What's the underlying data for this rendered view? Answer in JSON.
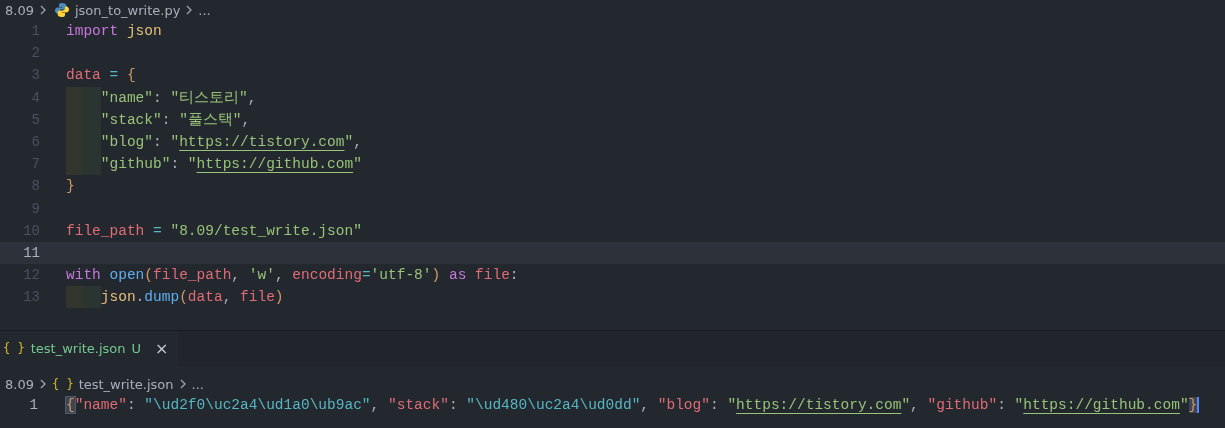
{
  "top_editor": {
    "breadcrumb": [
      {
        "text": "8.09"
      },
      {
        "text": "json_to_write.py"
      },
      {
        "text": "..."
      }
    ],
    "lines": [
      {
        "number": "1",
        "current": false,
        "indented": false,
        "tokens": [
          {
            "text": "import ",
            "kind": "keyword"
          },
          {
            "text": "json",
            "kind": "module"
          }
        ]
      },
      {
        "number": "2",
        "current": false,
        "indented": false
      },
      {
        "number": "3",
        "current": false,
        "indented": false,
        "tokens": [
          {
            "text": "data",
            "kind": "variable"
          },
          {
            "text": " = ",
            "kind": "operator"
          },
          {
            "text": "{",
            "kind": "brace"
          }
        ]
      },
      {
        "number": "4",
        "current": false,
        "indented": true,
        "tokens": [
          {
            "text": "\"name\"",
            "kind": "string"
          },
          {
            "text": ": ",
            "kind": "plain"
          },
          {
            "text": "\"티스토리\"",
            "kind": "string"
          },
          {
            "text": ",",
            "kind": "plain"
          }
        ]
      },
      {
        "number": "5",
        "current": false,
        "indented": true,
        "tokens": [
          {
            "text": "\"stack\"",
            "kind": "string"
          },
          {
            "text": ": ",
            "kind": "plain"
          },
          {
            "text": "\"풀스택\"",
            "kind": "string"
          },
          {
            "text": ",",
            "kind": "plain"
          }
        ]
      },
      {
        "number": "6",
        "current": false,
        "indented": true,
        "tokens": [
          {
            "text": "\"blog\"",
            "kind": "string"
          },
          {
            "text": ": ",
            "kind": "plain"
          },
          {
            "text": "\"",
            "kind": "string"
          },
          {
            "text": "https://tistory.com",
            "kind": "link"
          },
          {
            "text": "\"",
            "kind": "string"
          },
          {
            "text": ",",
            "kind": "plain"
          }
        ]
      },
      {
        "number": "7",
        "current": false,
        "indented": true,
        "tokens": [
          {
            "text": "\"github\"",
            "kind": "string"
          },
          {
            "text": ": ",
            "kind": "plain"
          },
          {
            "text": "\"",
            "kind": "string"
          },
          {
            "text": "https://github.com",
            "kind": "link"
          },
          {
            "text": "\"",
            "kind": "string"
          }
        ]
      },
      {
        "number": "8",
        "current": false,
        "indented": false,
        "tokens": [
          {
            "text": "}",
            "kind": "brace"
          }
        ]
      },
      {
        "number": "9",
        "current": false,
        "indented": false
      },
      {
        "number": "10",
        "current": false,
        "indented": false,
        "tokens": [
          {
            "text": "file_path",
            "kind": "variable"
          },
          {
            "text": " = ",
            "kind": "operator"
          },
          {
            "text": "\"8.09/test_write.json\"",
            "kind": "string"
          }
        ]
      },
      {
        "number": "11",
        "current": true,
        "indented": false
      },
      {
        "number": "12",
        "current": false,
        "indented": false,
        "tokens": [
          {
            "text": "with ",
            "kind": "keyword"
          },
          {
            "text": "open",
            "kind": "function"
          },
          {
            "text": "(",
            "kind": "brace"
          },
          {
            "text": "file_path",
            "kind": "variable"
          },
          {
            "text": ", ",
            "kind": "plain"
          },
          {
            "text": "'w'",
            "kind": "string"
          },
          {
            "text": ", ",
            "kind": "plain"
          },
          {
            "text": "encoding",
            "kind": "variable"
          },
          {
            "text": "=",
            "kind": "operator"
          },
          {
            "text": "'utf-8'",
            "kind": "string"
          },
          {
            "text": ")",
            "kind": "brace"
          },
          {
            "text": " as ",
            "kind": "keyword"
          },
          {
            "text": "file",
            "kind": "variable"
          },
          {
            "text": ":",
            "kind": "plain"
          }
        ]
      },
      {
        "number": "13",
        "current": false,
        "indented": true,
        "tokens": [
          {
            "text": "json",
            "kind": "module"
          },
          {
            "text": ".",
            "kind": "plain"
          },
          {
            "text": "dump",
            "kind": "function"
          },
          {
            "text": "(",
            "kind": "brace"
          },
          {
            "text": "data",
            "kind": "variable"
          },
          {
            "text": ", ",
            "kind": "plain"
          },
          {
            "text": "file",
            "kind": "variable"
          },
          {
            "text": ")",
            "kind": "brace"
          }
        ]
      }
    ]
  },
  "bottom_editor": {
    "tab": {
      "icon_glyph": "{ }",
      "label": "test_write.json",
      "status": "U",
      "close": "×",
      "selected": true
    },
    "breadcrumb": [
      {
        "text": "8.09"
      },
      {
        "icon_glyph": "{ }",
        "text": "test_write.json"
      },
      {
        "text": "..."
      }
    ],
    "lines": [
      {
        "number": "1",
        "tokens": [
          {
            "text": "{",
            "kind": "matched-brace"
          },
          {
            "text": "\"name\"",
            "kind": "key"
          },
          {
            "text": ": ",
            "kind": "plain"
          },
          {
            "text": "\"\\ud2f0\\uc2a4\\ud1a0\\ub9ac\"",
            "kind": "escape"
          },
          {
            "text": ", ",
            "kind": "plain"
          },
          {
            "text": "\"stack\"",
            "kind": "key"
          },
          {
            "text": ": ",
            "kind": "plain"
          },
          {
            "text": "\"\\ud480\\uc2a4\\ud0dd\"",
            "kind": "escape"
          },
          {
            "text": ", ",
            "kind": "plain"
          },
          {
            "text": "\"blog\"",
            "kind": "key"
          },
          {
            "text": ": ",
            "kind": "plain"
          },
          {
            "text": "\"",
            "kind": "string"
          },
          {
            "text": "https://tistory.com",
            "kind": "link"
          },
          {
            "text": "\"",
            "kind": "string"
          },
          {
            "text": ", ",
            "kind": "plain"
          },
          {
            "text": "\"github\"",
            "kind": "key"
          },
          {
            "text": ": ",
            "kind": "plain"
          },
          {
            "text": "\"",
            "kind": "string"
          },
          {
            "text": "https://github.com",
            "kind": "link"
          },
          {
            "text": "\"",
            "kind": "string"
          },
          {
            "text": "}",
            "kind": "cursor-brace"
          }
        ]
      }
    ]
  }
}
